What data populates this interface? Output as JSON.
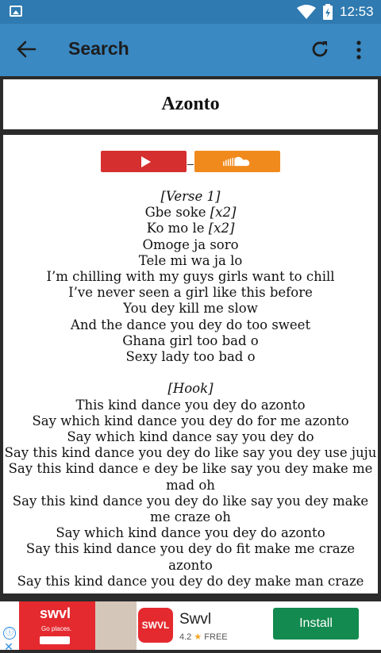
{
  "status_bar": {
    "time": "12:53"
  },
  "app_bar": {
    "title": "Search"
  },
  "song": {
    "title": "Azonto"
  },
  "media_buttons": {
    "separator": "_"
  },
  "lyrics": [
    {
      "text": "[Verse 1]",
      "italic": true
    },
    {
      "parts": [
        {
          "text": "Gbe soke "
        },
        {
          "text": "[x2]",
          "italic": true
        }
      ]
    },
    {
      "parts": [
        {
          "text": "Ko mo le "
        },
        {
          "text": "[x2]",
          "italic": true
        }
      ]
    },
    {
      "text": "Omoge ja soro"
    },
    {
      "text": "Tele mi wa ja lo"
    },
    {
      "text": "I’m chilling with my guys girls want to chill"
    },
    {
      "text": "I’ve never seen a girl like this before"
    },
    {
      "text": "You dey kill me slow"
    },
    {
      "text": "And the dance you dey do too sweet"
    },
    {
      "text": "Ghana girl too bad o"
    },
    {
      "text": "Sexy lady too bad o"
    },
    {
      "gap": true
    },
    {
      "text": "[Hook]",
      "italic": true
    },
    {
      "text": "This kind dance you dey do azonto"
    },
    {
      "text": "Say which kind dance you dey do for me azonto"
    },
    {
      "text": "Say which kind dance say you dey do"
    },
    {
      "text": "Say this kind dance you dey do like say you dey use juju",
      "wrap": true
    },
    {
      "text": "Say this kind dance e dey be like say you dey make me mad oh",
      "wrap": true
    },
    {
      "text": "Say this kind dance you dey do like say you dey make me craze oh",
      "wrap": true
    },
    {
      "text": "Say which kind dance you dey do azonto"
    },
    {
      "text": "Say this kind dance you dey do fit make me craze azonto",
      "wrap": true
    },
    {
      "text": "Say this kind dance you dey do dey make man craze"
    }
  ],
  "ad": {
    "banner_logo": "swvl",
    "banner_tagline": "Go places.",
    "app_logo": "SWVL",
    "app_name": "Swvl",
    "rating": "4.2",
    "price": "FREE",
    "install_label": "Install",
    "info_icon": "ⓘ",
    "close_icon": "✕",
    "colors": {
      "brand": "#e42a2f",
      "install": "#138a4f"
    }
  },
  "colors": {
    "app_bar": "#3b89c2",
    "status_bar": "#2f7ab0",
    "youtube": "#d62f2f",
    "soundcloud": "#f08a1d"
  }
}
